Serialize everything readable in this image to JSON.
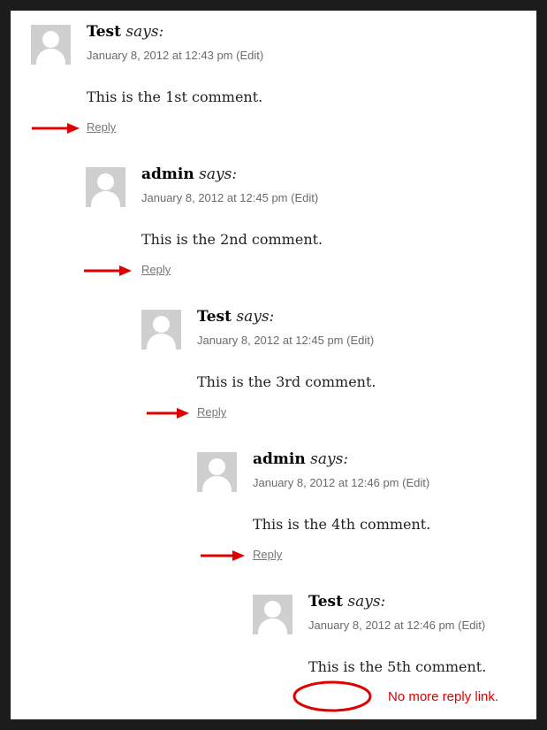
{
  "comments": [
    {
      "author": "Test",
      "says": "says:",
      "meta": "January 8, 2012 at 12:43 pm (Edit)",
      "body": "This is the 1st comment.",
      "reply": "Reply"
    },
    {
      "author": "admin",
      "says": "says:",
      "meta": "January 8, 2012 at 12:45 pm (Edit)",
      "body": "This is the 2nd comment.",
      "reply": "Reply"
    },
    {
      "author": "Test",
      "says": "says:",
      "meta": "January 8, 2012 at 12:45 pm (Edit)",
      "body": "This is the 3rd comment.",
      "reply": "Reply"
    },
    {
      "author": "admin",
      "says": "says:",
      "meta": "January 8, 2012 at 12:46 pm (Edit)",
      "body": "This is the 4th comment.",
      "reply": "Reply"
    },
    {
      "author": "Test",
      "says": "says:",
      "meta": "January 8, 2012 at 12:46 pm (Edit)",
      "body": "This is the 5th comment."
    }
  ],
  "annotation": {
    "note": "No more reply link.",
    "color": "#e00000"
  },
  "icons": {
    "avatar": "default-avatar-icon",
    "arrow": "red-arrow-icon",
    "circle": "red-circle-annotation"
  }
}
